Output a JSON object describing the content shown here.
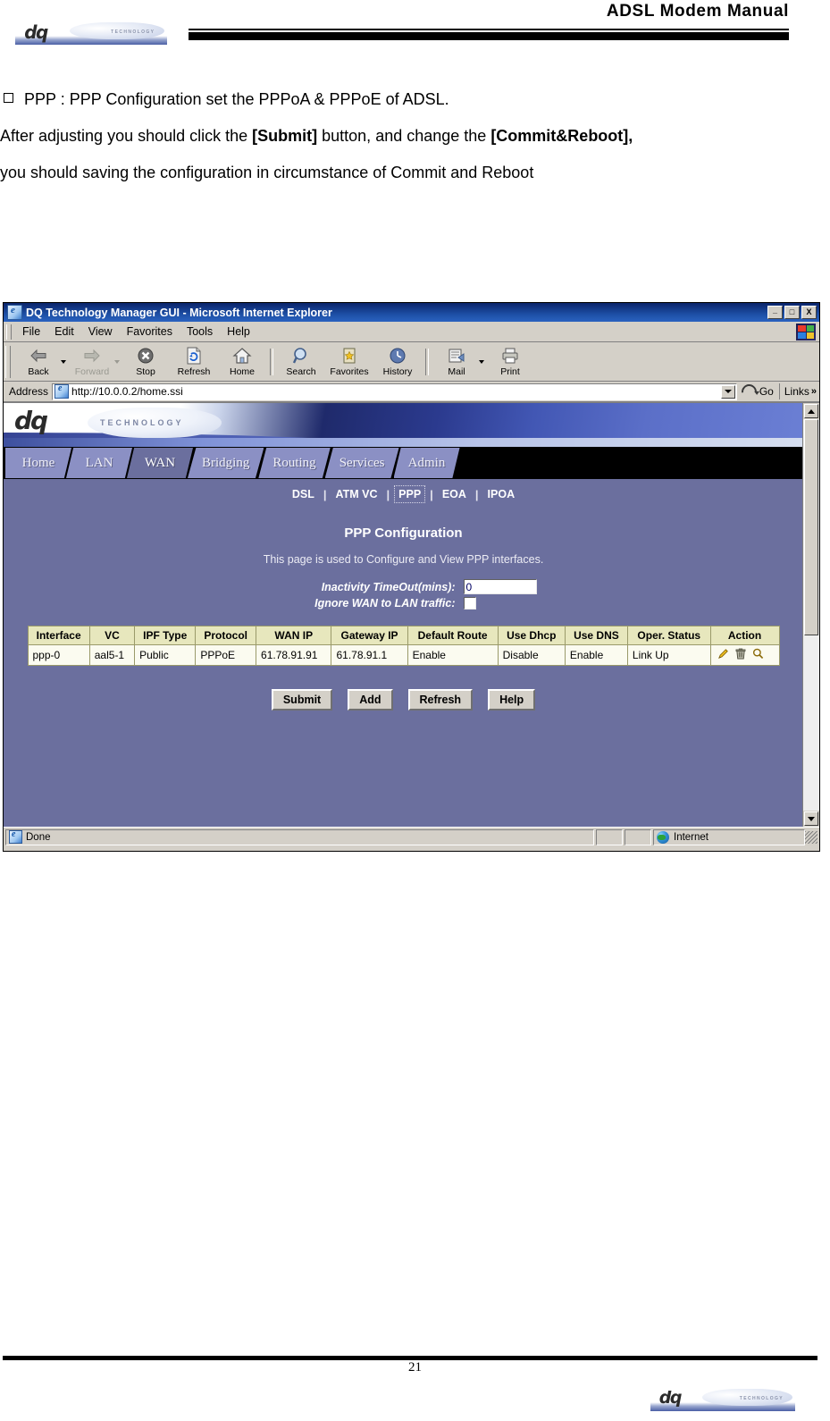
{
  "document": {
    "header_title": "ADSL Modem Manual",
    "logo_mark": "dq",
    "logo_tagline": "TECHNOLOGY",
    "page_number": "21",
    "paragraphs": {
      "bullet_line": "PPP : PPP Configuration set the PPPoA & PPPoE of ADSL.",
      "line2_a": "After adjusting you should click the ",
      "line2_submit": "[Submit]",
      "line2_b": " button, and change the ",
      "line2_commit": "[Commit&Reboot],",
      "line3": "you should saving the configuration in circumstance of Commit and Reboot"
    }
  },
  "browser": {
    "window_title": "DQ Technology Manager GUI - Microsoft Internet Explorer",
    "window_buttons": {
      "minimize": "_",
      "maximize": "□",
      "close": "X"
    },
    "menus": [
      "File",
      "Edit",
      "View",
      "Favorites",
      "Tools",
      "Help"
    ],
    "toolbar": [
      {
        "label": "Back",
        "icon": "back-arrow-icon",
        "disabled": false,
        "dropdown": true
      },
      {
        "label": "Forward",
        "icon": "forward-arrow-icon",
        "disabled": true,
        "dropdown": true
      },
      {
        "label": "Stop",
        "icon": "stop-icon",
        "disabled": false,
        "dropdown": false
      },
      {
        "label": "Refresh",
        "icon": "refresh-icon",
        "disabled": false,
        "dropdown": false
      },
      {
        "label": "Home",
        "icon": "home-icon",
        "disabled": false,
        "dropdown": false
      },
      {
        "label": "Search",
        "icon": "search-icon",
        "disabled": false,
        "dropdown": false
      },
      {
        "label": "Favorites",
        "icon": "favorites-star-icon",
        "disabled": false,
        "dropdown": false
      },
      {
        "label": "History",
        "icon": "history-clock-icon",
        "disabled": false,
        "dropdown": false
      },
      {
        "label": "Mail",
        "icon": "mail-icon",
        "disabled": false,
        "dropdown": true
      },
      {
        "label": "Print",
        "icon": "printer-icon",
        "disabled": false,
        "dropdown": false
      }
    ],
    "address": {
      "label": "Address",
      "url": "http://10.0.0.2/home.ssi",
      "go_label": "Go",
      "links_label": "Links",
      "links_chevron": "»"
    },
    "status": {
      "text": "Done",
      "zone": "Internet"
    }
  },
  "webpage": {
    "banner": {
      "mark": "dq",
      "tagline": "TECHNOLOGY"
    },
    "tabs": [
      {
        "label": "Home",
        "active": false
      },
      {
        "label": "LAN",
        "active": false
      },
      {
        "label": "WAN",
        "active": true
      },
      {
        "label": "Bridging",
        "active": false
      },
      {
        "label": "Routing",
        "active": false
      },
      {
        "label": "Services",
        "active": false
      },
      {
        "label": "Admin",
        "active": false
      }
    ],
    "subnav": [
      {
        "label": "DSL",
        "selected": false
      },
      {
        "label": "ATM VC",
        "selected": false
      },
      {
        "label": "PPP",
        "selected": true
      },
      {
        "label": "EOA",
        "selected": false
      },
      {
        "label": "IPOA",
        "selected": false
      }
    ],
    "subnav_separator": "|",
    "title": "PPP Configuration",
    "description": "This page is used to Configure and View PPP interfaces.",
    "form": {
      "inactivity_label": "Inactivity TimeOut(mins):",
      "inactivity_value": "0",
      "ignore_label": "Ignore WAN to LAN traffic:",
      "ignore_checked": false
    },
    "table": {
      "columns": [
        "Interface",
        "VC",
        "IPF Type",
        "Protocol",
        "WAN IP",
        "Gateway IP",
        "Default Route",
        "Use Dhcp",
        "Use DNS",
        "Oper. Status",
        "Action"
      ],
      "rows": [
        {
          "interface": "ppp-0",
          "vc": "aal5-1",
          "ipf_type": "Public",
          "protocol": "PPPoE",
          "wan_ip": "61.78.91.91",
          "gateway_ip": "61.78.91.1",
          "default_route": "Enable",
          "use_dhcp": "Disable",
          "use_dns": "Enable",
          "oper_status": "Link Up",
          "actions": [
            "edit-pencil-icon",
            "delete-trash-icon",
            "view-magnifier-icon"
          ]
        }
      ]
    },
    "buttons": [
      {
        "label": "Submit"
      },
      {
        "label": "Add"
      },
      {
        "label": "Refresh"
      },
      {
        "label": "Help"
      }
    ],
    "colors": {
      "page_background": "#6b6f9e",
      "tab_inactive": "#8b90c4",
      "tab_active": "#6b6f9e",
      "table_header": "#e7e7bd",
      "table_cell": "#fbfbf0",
      "status_link_up": "#1aa01a"
    }
  }
}
